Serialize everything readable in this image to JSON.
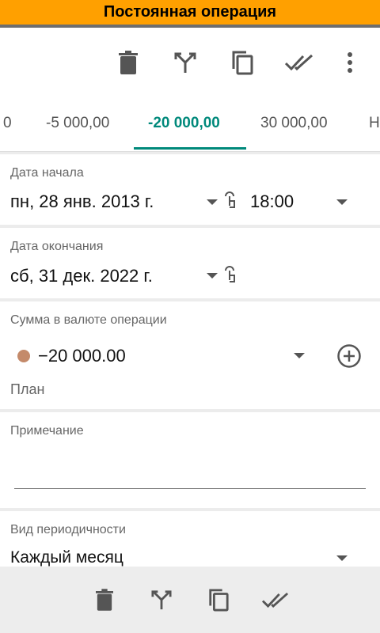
{
  "window": {
    "title": "Постоянная операция"
  },
  "toolbar": {
    "icons": [
      "delete-icon",
      "split-icon",
      "copy-icon",
      "done-all-icon",
      "more-vert-icon"
    ]
  },
  "tabs": [
    {
      "label": "0"
    },
    {
      "label": "-5 000,00"
    },
    {
      "label": "-20 000,00",
      "active": true
    },
    {
      "label": "30 000,00"
    },
    {
      "label": "Н"
    }
  ],
  "start_date": {
    "label": "Дата начала",
    "date": "пн, 28 янв. 2013 г.",
    "time": "18:00"
  },
  "end_date": {
    "label": "Дата окончания",
    "date": "сб, 31 дек. 2022 г."
  },
  "amount": {
    "label": "Сумма в валюте операции",
    "value": "−20 000.00",
    "status": "План",
    "dot_color": "#c48a6a"
  },
  "note": {
    "label": "Примечание",
    "value": ""
  },
  "periodicity": {
    "label": "Вид периодичности",
    "value": "Каждый месяц"
  },
  "colors": {
    "accent": "#00897b",
    "titlebar": "#ffa000"
  }
}
